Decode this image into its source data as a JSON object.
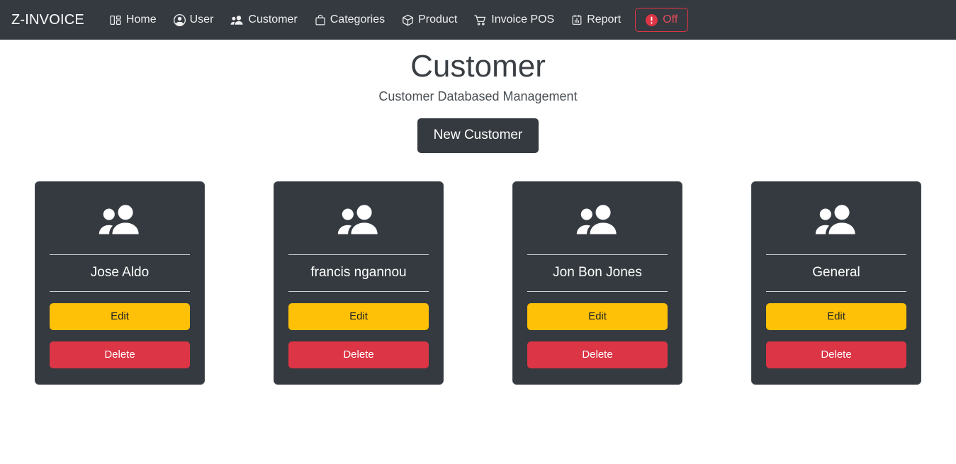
{
  "navbar": {
    "brand": "Z-INVOICE",
    "background_color": "#343a40",
    "links": [
      {
        "label": "Home",
        "icon": "layout-columns-icon"
      },
      {
        "label": "User",
        "icon": "person-circle-icon"
      },
      {
        "label": "Customer",
        "icon": "people-fill-icon"
      },
      {
        "label": "Categories",
        "icon": "bag-icon"
      },
      {
        "label": "Product",
        "icon": "box-icon"
      },
      {
        "label": "Invoice POS",
        "icon": "cart-icon"
      },
      {
        "label": "Report",
        "icon": "clipboard-chart-icon"
      }
    ],
    "off_button": {
      "label": "Off",
      "icon": "exclamation-circle-icon",
      "border_color": "#dc3545",
      "text_color": "#e04b5a"
    }
  },
  "header": {
    "title": "Customer",
    "subtitle": "Customer Databased Management",
    "new_button_label": "New Customer"
  },
  "cards": {
    "icon": "people-fill-icon",
    "edit_label": "Edit",
    "delete_label": "Delete",
    "edit_color": "#ffc107",
    "delete_color": "#dc3545",
    "card_background": "#343a40",
    "items": [
      {
        "name": "Jose Aldo"
      },
      {
        "name": "francis ngannou"
      },
      {
        "name": "Jon Bon Jones"
      },
      {
        "name": "General"
      }
    ]
  }
}
